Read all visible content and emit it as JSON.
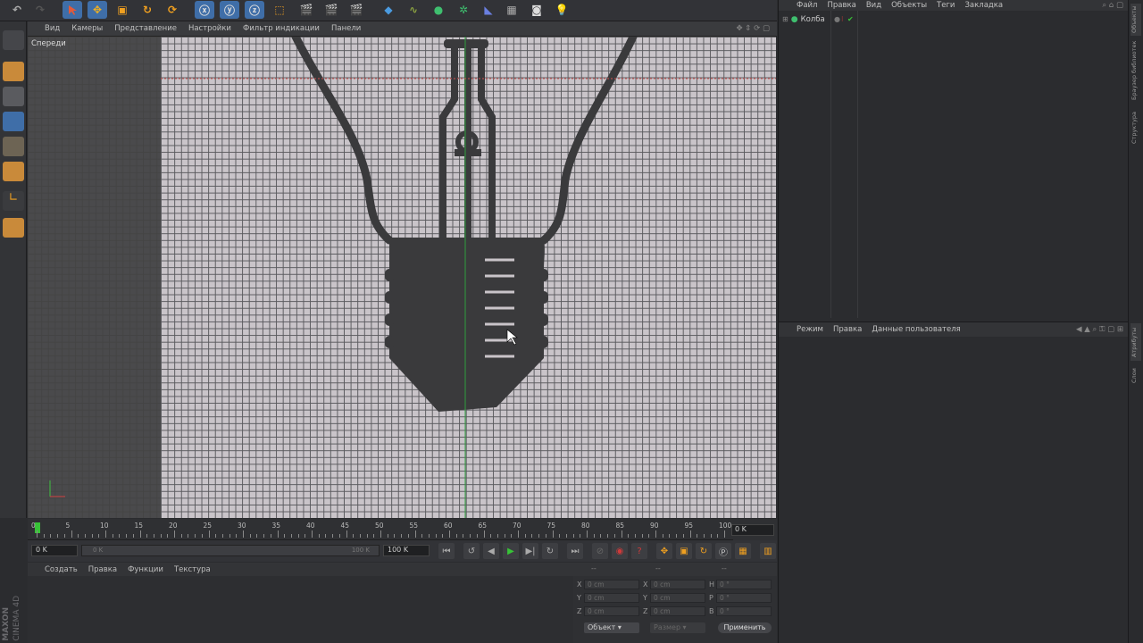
{
  "viewport": {
    "menu": [
      "Вид",
      "Камеры",
      "Представление",
      "Настройки",
      "Фильтр индикации",
      "Панели"
    ],
    "view_label": "Спереди"
  },
  "timeline": {
    "ticks": [
      "0",
      "5",
      "10",
      "15",
      "20",
      "25",
      "30",
      "35",
      "40",
      "45",
      "50",
      "55",
      "60",
      "65",
      "70",
      "75",
      "80",
      "85",
      "90",
      "95",
      "100"
    ],
    "current_frame_field": "0 K"
  },
  "transport": {
    "start_field": "0 K",
    "range_start": "0 K",
    "range_end": "100 K",
    "end_field": "100 K"
  },
  "material_manager": {
    "menu": [
      "Создать",
      "Правка",
      "Функции",
      "Текстура"
    ]
  },
  "coordinates": {
    "header_left": "--",
    "header_mid": "--",
    "header_right": "--",
    "rows": [
      {
        "pos_axis": "X",
        "pos_val": "0 cm",
        "size_axis": "X",
        "size_val": "0 cm",
        "rot_axis": "H",
        "rot_val": "0 °"
      },
      {
        "pos_axis": "Y",
        "pos_val": "0 cm",
        "size_axis": "Y",
        "size_val": "0 cm",
        "rot_axis": "P",
        "rot_val": "0 °"
      },
      {
        "pos_axis": "Z",
        "pos_val": "0 cm",
        "size_axis": "Z",
        "size_val": "0 cm",
        "rot_axis": "B",
        "rot_val": "0 °"
      }
    ],
    "mode_select": "Объект",
    "size_select": "Размер",
    "apply_button": "Применить"
  },
  "object_manager": {
    "menu": [
      "Файл",
      "Правка",
      "Вид",
      "Объекты",
      "Теги",
      "Закладка"
    ],
    "objects": [
      {
        "name": "Колба"
      }
    ]
  },
  "attribute_manager": {
    "menu": [
      "Режим",
      "Правка",
      "Данные пользователя"
    ]
  },
  "side_tabs": [
    "Объекты",
    "Браузер библиотек",
    "Структура",
    "Атрибуты",
    "Слои"
  ],
  "logo": {
    "line1": "MAXON",
    "line2": "CINEMA 4D"
  },
  "colors": {
    "accent_blue": "#3f6ea8",
    "play_green": "#37c337",
    "record_red": "#d03a3a"
  }
}
